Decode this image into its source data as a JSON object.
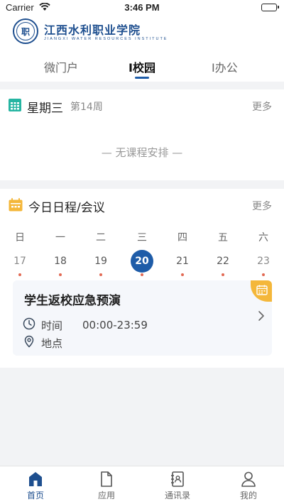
{
  "status_bar": {
    "carrier": "Carrier",
    "time": "3:46 PM"
  },
  "header": {
    "logo_text": "职",
    "school_name": "江西水利职业学院",
    "school_name_en": "JIANGXI WATER RESOURCES INSTITUTE"
  },
  "tabs": [
    {
      "label": "微门户"
    },
    {
      "label": "I校园",
      "active": true
    },
    {
      "label": "I办公"
    }
  ],
  "course_card": {
    "title": "星期三",
    "week": "第14周",
    "more": "更多",
    "empty_text": "—  无课程安排  —",
    "icon": "grid-calendar-icon"
  },
  "schedule_card": {
    "title": "今日日程/会议",
    "more": "更多",
    "icon": "calendar-icon",
    "weekdays": [
      "日",
      "一",
      "二",
      "三",
      "四",
      "五",
      "六"
    ],
    "dates": [
      "17",
      "18",
      "19",
      "20",
      "21",
      "22",
      "23"
    ],
    "selected_index": 3
  },
  "event": {
    "title": "学生返校应急预演",
    "time_label": "时间",
    "time_value": "00:00-23:59",
    "place_label": "地点"
  },
  "tabbar": [
    {
      "label": "首页",
      "icon": "home-icon",
      "active": true
    },
    {
      "label": "应用",
      "icon": "document-icon"
    },
    {
      "label": "通讯录",
      "icon": "contacts-book-icon"
    },
    {
      "label": "我的",
      "icon": "person-icon"
    }
  ],
  "colors": {
    "primary": "#1e5ca8",
    "accent": "#f4b73a",
    "dot": "#e26a54",
    "teal": "#26b5a2"
  }
}
